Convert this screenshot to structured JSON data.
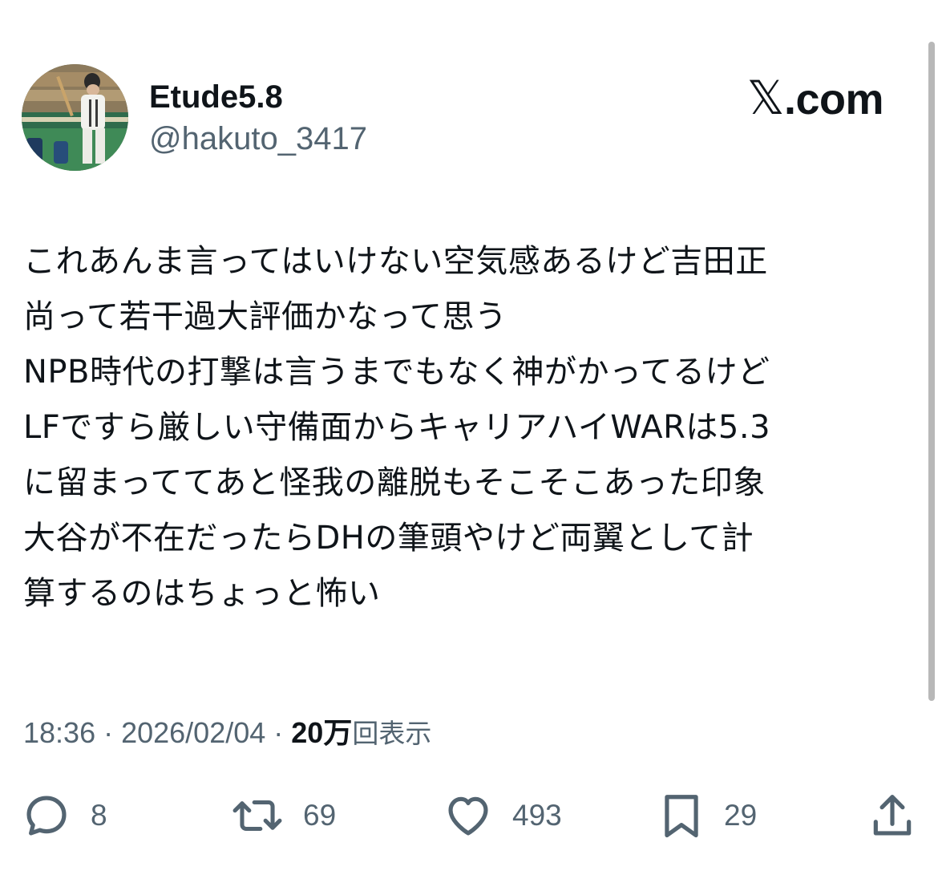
{
  "author": {
    "display_name": "Etude5.8",
    "handle": "@hakuto_3417"
  },
  "brand": {
    "x_glyph": "𝕏",
    "text": ".com"
  },
  "post": {
    "lines": [
      "これあんま言ってはいけない空気感あるけど吉田正",
      "尚って若干過大評価かなって思う",
      "NPB時代の打撃は言うまでもなく神がかってるけど",
      "LFですら厳しい守備面からキャリアハイWARは5.3",
      "に留まっててあと怪我の離脱もそこそこあった印象",
      "大谷が不在だったらDHの筆頭やけど両翼として計",
      "算するのはちょっと怖い"
    ]
  },
  "meta": {
    "time": "18:36",
    "separator": " · ",
    "date": "2026/02/04",
    "views_number": "20万",
    "views_label": "回表示"
  },
  "actions": {
    "replies": "8",
    "reposts": "69",
    "likes": "493",
    "bookmarks": "29"
  },
  "colors": {
    "text_primary": "#0f1419",
    "text_secondary": "#536471",
    "background": "#ffffff"
  },
  "icons": {
    "reply": "reply-icon",
    "repost": "repost-icon",
    "like": "heart-icon",
    "bookmark": "bookmark-icon",
    "share": "share-icon"
  }
}
